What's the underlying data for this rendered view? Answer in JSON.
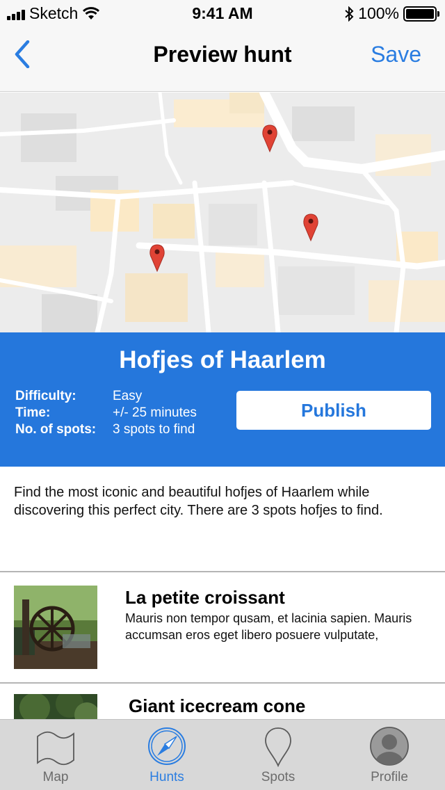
{
  "status_bar": {
    "carrier": "Sketch",
    "time": "9:41 AM",
    "battery": "100%"
  },
  "nav": {
    "title": "Preview hunt",
    "save_label": "Save"
  },
  "map": {
    "pins": 3
  },
  "hunt": {
    "title": "Hofjes of Haarlem",
    "meta": [
      {
        "key": "Difficulty:",
        "value": "Easy"
      },
      {
        "key": "Time:",
        "value": "+/- 25 minutes"
      },
      {
        "key": "No. of spots:",
        "value": "3 spots to find"
      }
    ],
    "publish_label": "Publish",
    "description": "Find the most iconic and beautiful hofjes of Haarlem while discovering this perfect city. There are 3 spots hofjes to find."
  },
  "spots": [
    {
      "title": "La petite croissant",
      "description": "Mauris non tempor qusam, et lacinia sapien. Mauris accumsan eros eget libero posuere vulputate,"
    },
    {
      "title": "Giant icecream cone",
      "description": ""
    }
  ],
  "tabs": [
    {
      "label": "Map",
      "icon": "map-icon",
      "active": false
    },
    {
      "label": "Hunts",
      "icon": "compass-icon",
      "active": true
    },
    {
      "label": "Spots",
      "icon": "pin-icon",
      "active": false
    },
    {
      "label": "Profile",
      "icon": "profile-icon",
      "active": false
    }
  ],
  "colors": {
    "accent": "#2a7de1",
    "header_bg": "#2577dc",
    "pin": "#e04335"
  }
}
